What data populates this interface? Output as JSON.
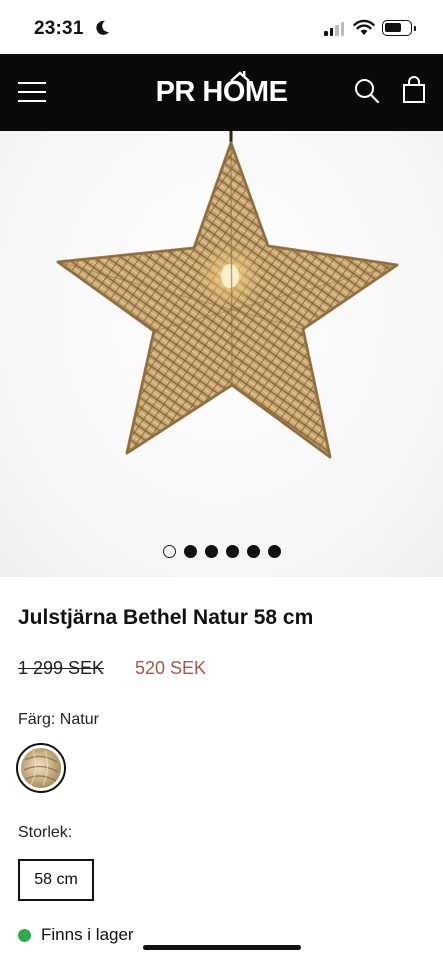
{
  "status_bar": {
    "time": "23:31",
    "icons": [
      "moon-icon",
      "signal-icon",
      "wifi-icon",
      "battery-icon"
    ]
  },
  "header": {
    "logo_text": "PR HOME",
    "icons": [
      "menu-icon",
      "search-icon",
      "cart-icon"
    ],
    "background_color": "#0a0a0a"
  },
  "gallery": {
    "slide_count": 6,
    "active_slide": 1
  },
  "product": {
    "title": "Julstjärna Bethel Natur 58 cm",
    "price_original": "1 299 SEK",
    "price_sale": "520 SEK",
    "sale_color": "#a05a4a"
  },
  "options": {
    "color_label": "Färg: Natur",
    "size_label": "Storlek:",
    "size_value": "58 cm"
  },
  "stock": {
    "text": "Finns i lager",
    "status_color": "#2fa84f"
  }
}
